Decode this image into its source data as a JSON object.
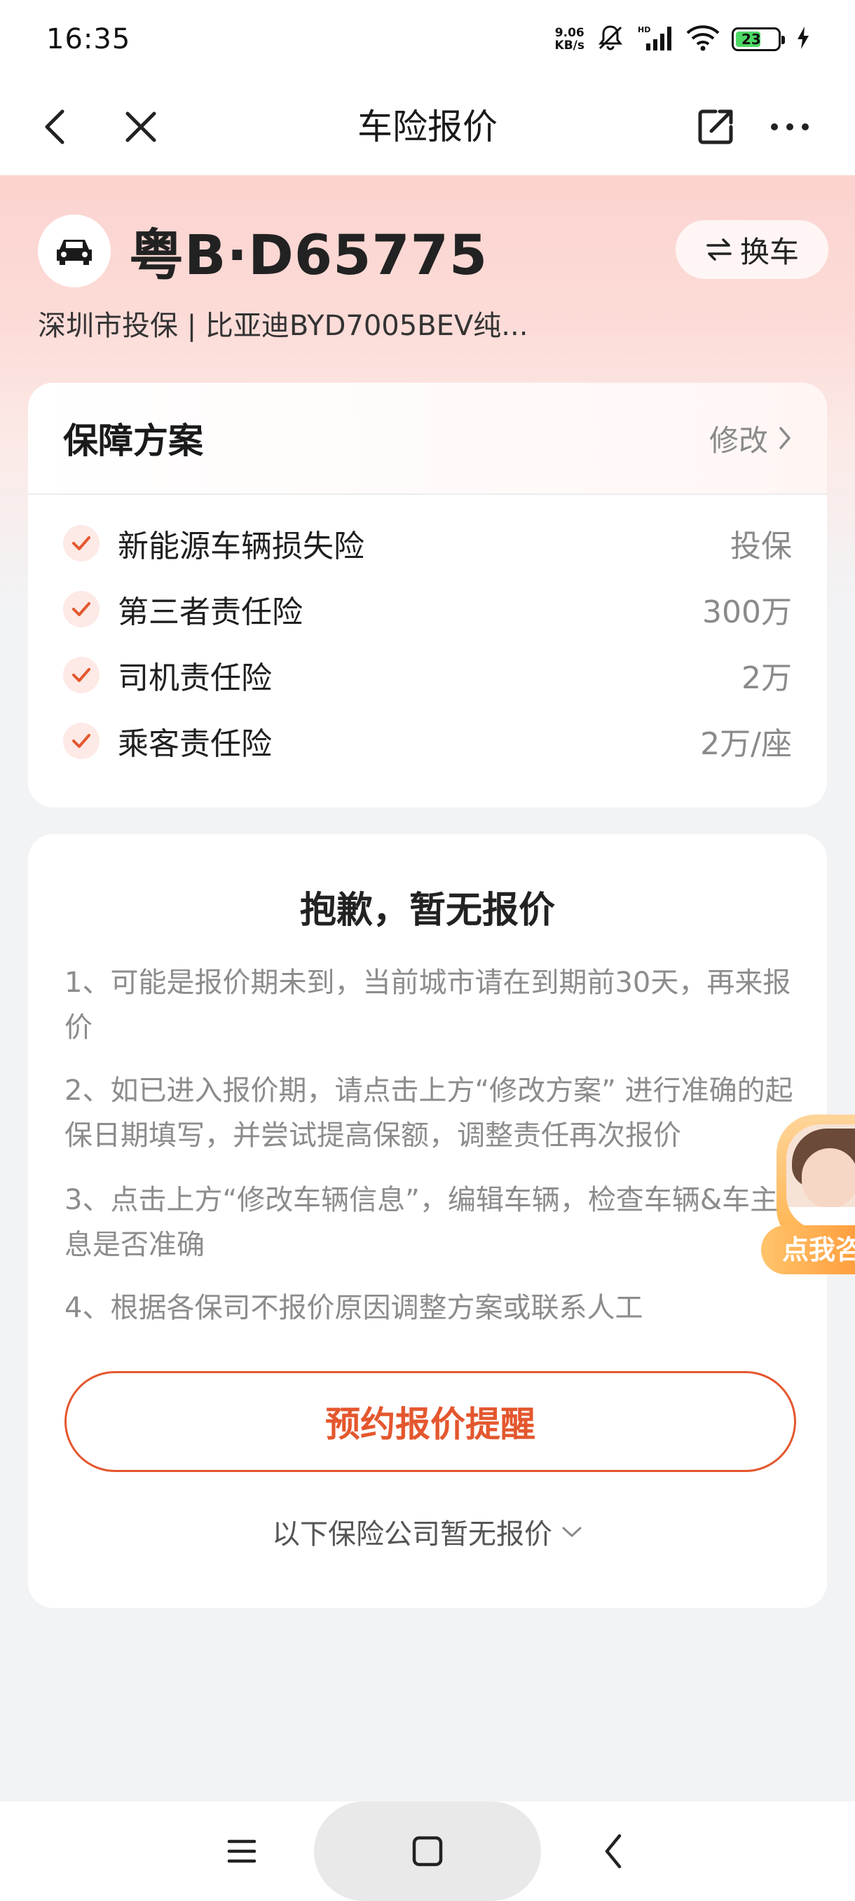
{
  "status_bar": {
    "time": "16:35",
    "net_speed_value": "9.06",
    "net_speed_unit": "KB/s",
    "battery_level": "23"
  },
  "nav": {
    "title": "车险报价"
  },
  "vehicle": {
    "plate": "粤B·D65775",
    "change_label": "换车",
    "info": "深圳市投保 | 比亚迪BYD7005BEV纯..."
  },
  "plan": {
    "title": "保障方案",
    "edit_label": "修改",
    "items": [
      {
        "name": "新能源车辆损失险",
        "value": "投保"
      },
      {
        "name": "第三者责任险",
        "value": "300万"
      },
      {
        "name": "司机责任险",
        "value": "2万"
      },
      {
        "name": "乘客责任险",
        "value": "2万/座"
      }
    ]
  },
  "no_quote": {
    "title": "抱歉，暂无报价",
    "tips": [
      "1、可能是报价期未到，当前城市请在到期前30天，再来报价",
      "2、如已进入报价期，请点击上方“修改方案” 进行准确的起保日期填写，并尝试提高保额，调整责任再次报价",
      "3、点击上方“修改车辆信息”，编辑车辆，检查车辆&车主信息是否准确",
      "4、根据各保司不报价原因调整方案或联系人工"
    ],
    "remind_button": "预约报价提醒",
    "expand_label": "以下保险公司暂无报价"
  },
  "service_widget": {
    "label": "点我咨询"
  },
  "colors": {
    "accent": "#e4572e",
    "hero_pink": "#fbd3cf",
    "background": "#f2f3f5"
  }
}
